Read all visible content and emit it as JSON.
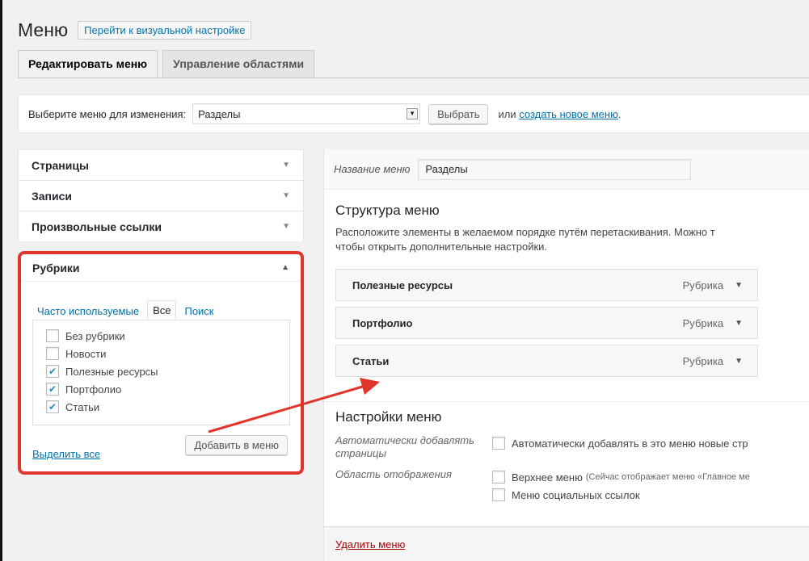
{
  "header": {
    "title": "Меню",
    "visual_settings_button": "Перейти к визуальной настройке"
  },
  "tabs": [
    {
      "label": "Редактировать меню",
      "active": true
    },
    {
      "label": "Управление областями",
      "active": false
    }
  ],
  "select_bar": {
    "label": "Выберите меню для изменения:",
    "selected": "Разделы",
    "select_button": "Выбрать",
    "or_text": "или",
    "create_link": "создать новое меню",
    "period": "."
  },
  "sidebar": {
    "sections": [
      {
        "label": "Страницы"
      },
      {
        "label": "Записи"
      },
      {
        "label": "Произвольные ссылки"
      }
    ],
    "rubriki": {
      "title": "Рубрики",
      "tabs": [
        "Часто используемые",
        "Все",
        "Поиск"
      ],
      "items": [
        {
          "label": "Без рубрики",
          "checked": false
        },
        {
          "label": "Новости",
          "checked": false
        },
        {
          "label": "Полезные ресурсы",
          "checked": true
        },
        {
          "label": "Портфолио",
          "checked": true
        },
        {
          "label": "Статьи",
          "checked": true
        }
      ],
      "select_all": "Выделить все",
      "add_button": "Добавить в меню",
      "highlight_color": "#e0352b"
    }
  },
  "main": {
    "name_label": "Название меню",
    "name_value": "Разделы",
    "structure_title": "Структура меню",
    "structure_desc_line1": "Расположите элементы в желаемом порядке путём перетаскивания. Можно т",
    "structure_desc_line2": "чтобы открыть дополнительные настройки.",
    "menu_items": [
      {
        "label": "Полезные ресурсы",
        "type": "Рубрика"
      },
      {
        "label": "Портфолио",
        "type": "Рубрика"
      },
      {
        "label": "Статьи",
        "type": "Рубрика"
      }
    ],
    "settings_title": "Настройки меню",
    "auto_label": "Автоматически добавлять страницы",
    "auto_option": "Автоматически добавлять в это меню новые стр",
    "area_label": "Область отображения",
    "area_option1": "Верхнее меню",
    "area_option1_note": "(Сейчас отображает меню «Главное ме",
    "area_option2": "Меню социальных ссылок",
    "delete_link": "Удалить меню"
  },
  "icons": {
    "dropdown": "▼",
    "collapse": "▲",
    "check": "✔"
  }
}
